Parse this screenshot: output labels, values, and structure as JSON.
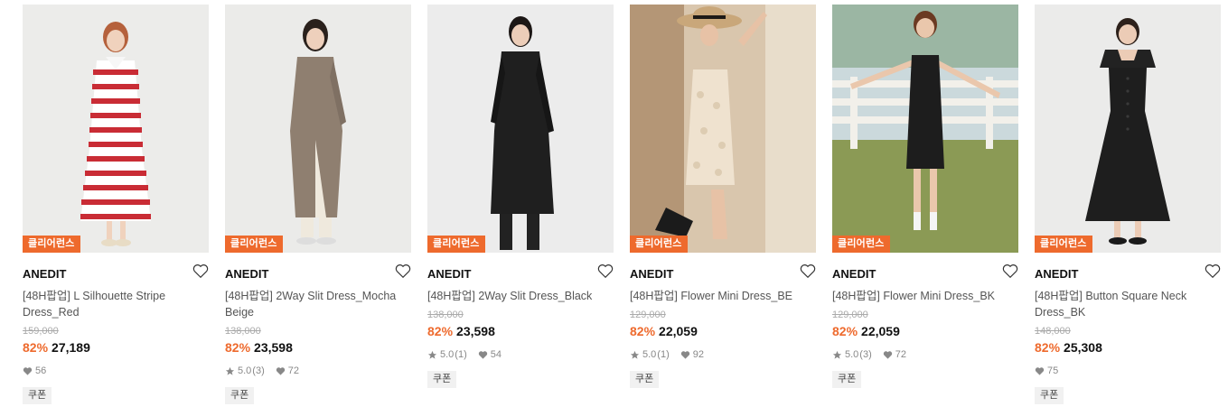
{
  "products": [
    {
      "badge": "클리어런스",
      "brand": "ANEDIT",
      "name": "[48H팝업] L Silhouette Stripe Dress_Red",
      "original_price": "159,000",
      "discount": "82%",
      "price": "27,189",
      "rating": "",
      "review_count": "",
      "likes": "56",
      "coupon": "쿠폰"
    },
    {
      "badge": "클리어런스",
      "brand": "ANEDIT",
      "name": "[48H팝업] 2Way Slit Dress_Mocha Beige",
      "original_price": "138,000",
      "discount": "82%",
      "price": "23,598",
      "rating": "5.0",
      "review_count": "(3)",
      "likes": "72",
      "coupon": "쿠폰"
    },
    {
      "badge": "클리어런스",
      "brand": "ANEDIT",
      "name": "[48H팝업] 2Way Slit Dress_Black",
      "original_price": "138,000",
      "discount": "82%",
      "price": "23,598",
      "rating": "5.0",
      "review_count": "(1)",
      "likes": "54",
      "coupon": "쿠폰"
    },
    {
      "badge": "클리어런스",
      "brand": "ANEDIT",
      "name": "[48H팝업] Flower Mini Dress_BE",
      "original_price": "129,000",
      "discount": "82%",
      "price": "22,059",
      "rating": "5.0",
      "review_count": "(1)",
      "likes": "92",
      "coupon": "쿠폰"
    },
    {
      "badge": "클리어런스",
      "brand": "ANEDIT",
      "name": "[48H팝업] Flower Mini Dress_BK",
      "original_price": "129,000",
      "discount": "82%",
      "price": "22,059",
      "rating": "5.0",
      "review_count": "(3)",
      "likes": "72",
      "coupon": "쿠폰"
    },
    {
      "badge": "클리어런스",
      "brand": "ANEDIT",
      "name": "[48H팝업] Button Square Neck Dress_BK",
      "original_price": "148,000",
      "discount": "82%",
      "price": "25,308",
      "rating": "",
      "review_count": "",
      "likes": "75",
      "coupon": "쿠폰"
    }
  ],
  "colors": {
    "accent": "#ee6a2d",
    "badge_bg": "#ee6a2d",
    "coupon_bg": "#f1f1f1",
    "muted_text": "#888888"
  },
  "icons": {
    "wishlist": "heart-outline-icon",
    "likes": "heart-filled-icon",
    "rating": "star-icon"
  }
}
